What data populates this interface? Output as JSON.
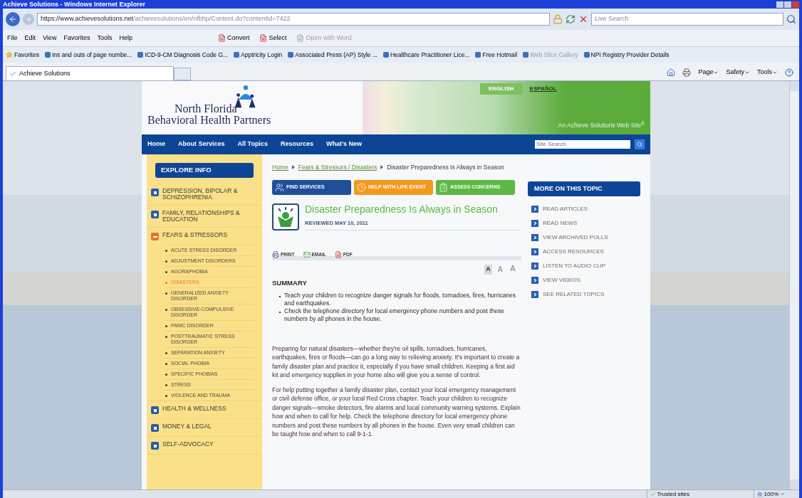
{
  "window": {
    "title": "Achieve Solutions - Windows Internet Explorer"
  },
  "address_bar": {
    "url_host": "https://www.achievesolutions.net",
    "url_path": "/achievesolutions/en/nfbhp/Content.do?contentId=7422"
  },
  "search": {
    "placeholder": "Live Search"
  },
  "menu": [
    "File",
    "Edit",
    "View",
    "Favorites",
    "Tools",
    "Help"
  ],
  "toolbar": [
    "Convert",
    "Select",
    "Open with Word"
  ],
  "favorites_bar": {
    "label": "Favorites",
    "items": [
      "Ins and outs of page numbe...",
      "ICD-9-CM Diagnosis Code G...",
      "Apptricity Login",
      "Associated Press (AP) Style ...",
      "Healthcare Practitioner Lice...",
      "Free Hotmail",
      "Web Slice Gallery",
      "NPI Registry Provider Details"
    ]
  },
  "tabs": [
    {
      "label": "Achieve Solutions",
      "selected": true
    }
  ],
  "command_bar": [
    "Page",
    "Safety",
    "Tools"
  ],
  "site": {
    "logo": [
      "North Florida",
      "Behavioral Health Partners"
    ],
    "languages": [
      {
        "label": "ENGLISH",
        "selected": true
      },
      {
        "label": "ESPAÑOL",
        "selected": false
      }
    ],
    "tagline": "An Achieve Solutions Web Site$^{®}$",
    "nav": [
      "Home",
      "About Services",
      "All Topics",
      "Resources",
      "What's New"
    ],
    "site_search": {
      "placeholder": "Site Search"
    },
    "sidebar": {
      "title": "EXPLORE INFO",
      "items": [
        {
          "label": "DEPRESSION, BIPOLAR & SCHIZOPHRENIA",
          "expanded": false
        },
        {
          "label": "FAMILY, RELATIONSHIPS & EDUCATION",
          "expanded": false
        },
        {
          "label": "FEARS & STRESSORS",
          "expanded": true,
          "children": [
            {
              "label": "ACUTE STRESS DISORDER",
              "selected": false
            },
            {
              "label": "ADJUSTMENT DISORDERS",
              "selected": false
            },
            {
              "label": "AGORAPHOBIA",
              "selected": false
            },
            {
              "label": "DISASTERS",
              "selected": true
            },
            {
              "label": "GENERALIZED ANXIETY DISORDER",
              "selected": false
            },
            {
              "label": "OBSESSIVE-COMPULSIVE DISORDER",
              "selected": false
            },
            {
              "label": "PANIC DISORDER",
              "selected": false
            },
            {
              "label": "POSTTRAUMATIC STRESS DISORDER",
              "selected": false
            },
            {
              "label": "SEPARATION ANXIETY",
              "selected": false
            },
            {
              "label": "SOCIAL PHOBIA",
              "selected": false
            },
            {
              "label": "SPECIFIC PHOBIAS",
              "selected": false
            },
            {
              "label": "STRESS",
              "selected": false
            },
            {
              "label": "VIOLENCE AND TRAUMA",
              "selected": false
            }
          ]
        },
        {
          "label": "HEALTH & WELLNESS",
          "expanded": false
        },
        {
          "label": "MONEY & LEGAL",
          "expanded": false
        },
        {
          "label": "SELF-ADVOCACY",
          "expanded": false
        }
      ]
    },
    "breadcrumb": [
      {
        "label": "Home",
        "kind": "link"
      },
      {
        "label": "Fears & Stressors / Disasters",
        "kind": "link"
      },
      {
        "label": "Disaster Preparedness Is Always in Season",
        "kind": "current"
      }
    ],
    "action_buttons": [
      {
        "label": "FIND SERVICES",
        "color": "#1f4f9a"
      },
      {
        "label": "HELP WITH LIFE EVENT",
        "color": "#f39a1e"
      },
      {
        "label": "ASSESS CONCERNS",
        "color": "#5cb845"
      }
    ],
    "article": {
      "title": "Disaster Preparedness Is Always in Season",
      "reviewed": "REVIEWED MAY 10, 2011",
      "tools": [
        "PRINT",
        "EMAIL",
        "PDF"
      ],
      "font_sizes": [
        {
          "label": "A",
          "selected": true
        },
        {
          "label": "A",
          "selected": false
        },
        {
          "label": "A",
          "selected": false
        }
      ],
      "summary_heading": "SUMMARY",
      "summary": [
        "Teach your children to recognize danger signals for floods, tornadoes, fires, hurricanes and earthquakes.",
        "Check the telephone directory for local emergency phone numbers and post these numbers by all phones in the house."
      ],
      "paragraphs": [
        "Preparing for natural disasters—whether they're oil spills, tornadoes, hurricanes, earthquakes, fires or floods—can go a long way to relieving anxiety. It's important to create a family disaster plan and practice it, especially if you have small children. Keeping a first aid kit and emergency supplies in your home also will give you a sense of control.",
        "For help putting together a family disaster plan, contact your local emergency management or civil defense office, or your local Red Cross chapter. Teach your children to recognize danger signals—smoke detectors, fire alarms and local community warning systems. Explain how and when to call for help. Check the telephone directory for local emergency phone numbers and post these numbers by all phones in the house. Even very small children can be taught how and when to call 9-1-1."
      ]
    },
    "more_on_topic": {
      "title": "MORE ON THIS TOPIC",
      "links": [
        "READ ARTICLES",
        "READ NEWS",
        "VIEW ARCHIVED POLLS",
        "ACCESS RESOURCES",
        "LISTEN TO AUDIO CLIP",
        "VIEW VIDEOS",
        "SEE RELATED TOPICS"
      ]
    }
  },
  "status_bar": {
    "zone": "Trusted sites",
    "zoom": "100%"
  }
}
